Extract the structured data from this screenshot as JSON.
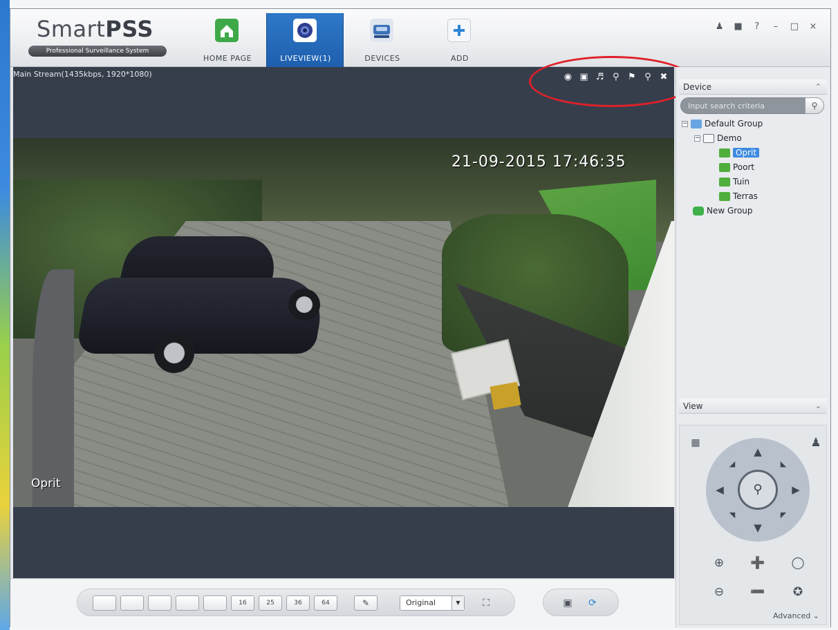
{
  "app": {
    "logo_main": "Smart",
    "logo_bold": "PSS",
    "logo_sub": "Professional Surveillance System"
  },
  "nav_tabs": [
    {
      "label": "HOME PAGE",
      "icon": "house-icon",
      "color": "#3fa94a"
    },
    {
      "label": "LIVEVIEW(1)",
      "icon": "camera-lens-icon",
      "color": "#2f3e8e"
    },
    {
      "label": "DEVICES",
      "icon": "dvr-icon",
      "color": "#3d72b8"
    },
    {
      "label": "ADD",
      "icon": "plus-icon",
      "color": "#2d85d6"
    }
  ],
  "window_controls": {
    "user": "user-icon",
    "lock": "lock-icon",
    "help": "?",
    "minimize": "–",
    "maximize": "□",
    "close": "×"
  },
  "video": {
    "stream_info": "Main Stream(1435kbps, 1920*1080)",
    "osd_timestamp": "21-09-2015 17:46:35",
    "osd_channel": "Oprit",
    "toolbar_icons": [
      "record-icon",
      "snapshot-icon",
      "audio-icon",
      "talk-icon",
      "flag-icon",
      "zoom-icon",
      "close-icon"
    ]
  },
  "bottom": {
    "layouts": [
      "",
      "",
      "",
      "",
      "",
      "16",
      "25",
      "36",
      "64"
    ],
    "stream_select": "Original",
    "icons": [
      "pen-icon",
      "fullscreen-icon",
      "save-icon",
      "refresh-icon"
    ]
  },
  "device_panel": {
    "title": "Device",
    "search_placeholder": "Input search criteria",
    "tree": [
      {
        "label": "Default Group",
        "level": 0,
        "toggle": "−",
        "type": "group"
      },
      {
        "label": "Demo",
        "level": 1,
        "toggle": "−",
        "type": "device"
      },
      {
        "label": "Oprit",
        "level": 2,
        "toggle": "",
        "type": "camera",
        "selected": true
      },
      {
        "label": "Poort",
        "level": 2,
        "toggle": "",
        "type": "camera"
      },
      {
        "label": "Tuin",
        "level": 2,
        "toggle": "",
        "type": "camera"
      },
      {
        "label": "Terras",
        "level": 2,
        "toggle": "",
        "type": "camera"
      },
      {
        "label": "New Group",
        "level": 0,
        "toggle": "",
        "type": "new-group"
      }
    ]
  },
  "view_panel": {
    "title": "View",
    "advanced_label": "Advanced"
  },
  "colors": {
    "active_tab": "#1e5fae",
    "selection": "#3d8ae0",
    "annotation": "#e0202a",
    "video_bg": "#363e4c"
  }
}
